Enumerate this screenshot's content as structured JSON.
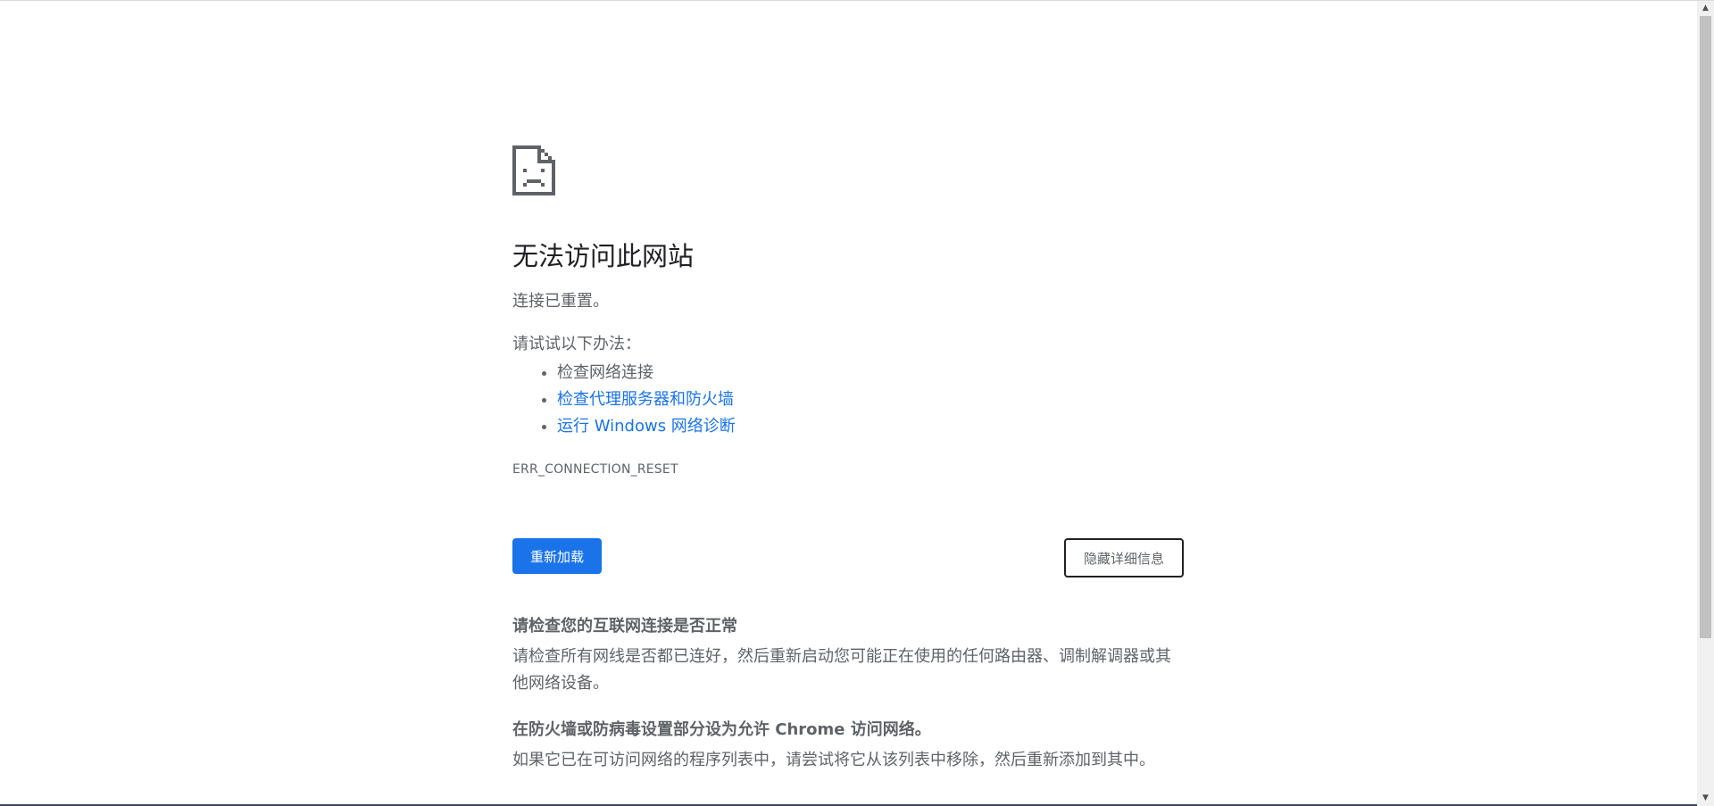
{
  "error_page": {
    "icon": "sad-page-icon",
    "title": "无法访问此网站",
    "summary": "连接已重置。",
    "suggestions_heading": "请试试以下办法：",
    "suggestions": [
      {
        "label": "检查网络连接",
        "is_link": false
      },
      {
        "label": "检查代理服务器和防火墙",
        "is_link": true
      },
      {
        "label": "运行 Windows 网络诊断",
        "is_link": true
      }
    ],
    "error_code": "ERR_CONNECTION_RESET",
    "reload_label": "重新加载",
    "details_toggle_label": "隐藏详细信息",
    "details": [
      {
        "heading": "请检查您的互联网连接是否正常",
        "body": "请检查所有网线是否都已连好，然后重新启动您可能正在使用的任何路由器、调制解调器或其他网络设备。"
      },
      {
        "heading": "在防火墙或防病毒设置部分设为允许 Chrome 访问网络。",
        "body": "如果它已在可访问网络的程序列表中，请尝试将它从该列表中移除，然后重新添加到其中。"
      }
    ]
  },
  "colors": {
    "accent": "#1a73e8",
    "text": "#5f6368",
    "title": "#202124"
  }
}
